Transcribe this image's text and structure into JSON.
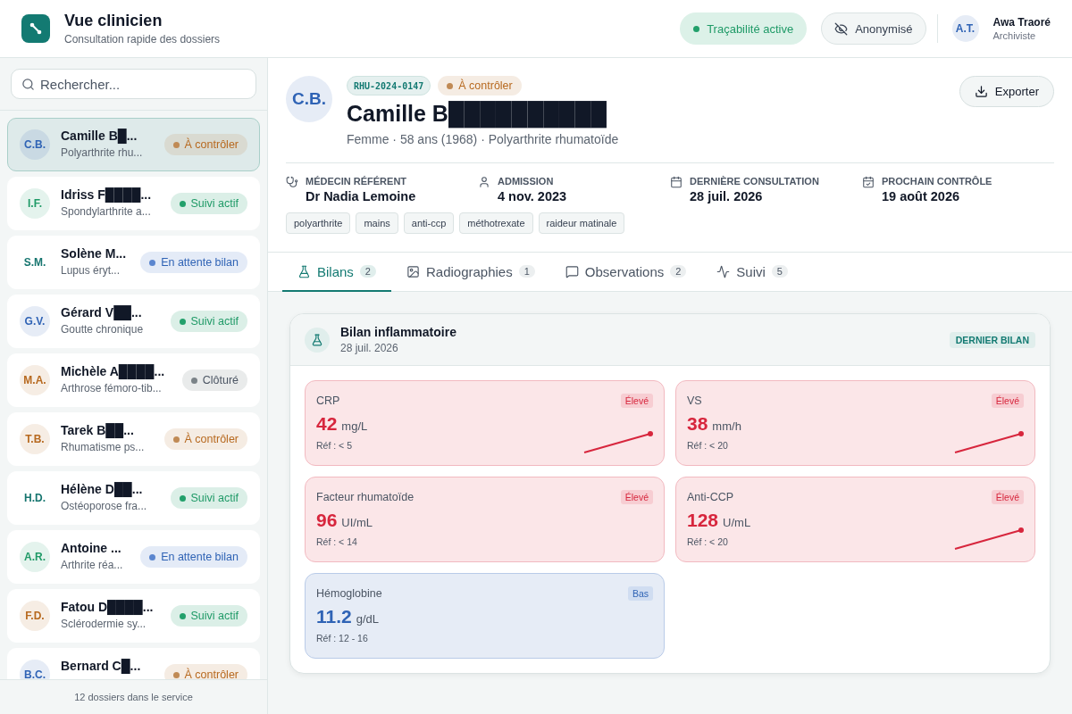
{
  "app": {
    "title": "Vue clinicien",
    "subtitle": "Consultation rapide des dossiers"
  },
  "header_actions": [
    {
      "kind": "status",
      "label": "Traçabilité active",
      "on": true
    },
    {
      "kind": "toggle",
      "label": "Anonymisé",
      "on": false
    }
  ],
  "user": {
    "initials": "A.T.",
    "name": "Awa Traoré",
    "role": "Archiviste"
  },
  "search": {
    "placeholder": "Rechercher..."
  },
  "patients": [
    {
      "avatar": {
        "initials": "C.B.",
        "color": "#2f63b5"
      },
      "name": "Camille B█...",
      "condition": "Polyarthrite rhu...",
      "status": {
        "label": "À contrôler",
        "color": "#c08a55"
      },
      "selected": true
    },
    {
      "avatar": {
        "initials": "I.F.",
        "color": "#1f9a67"
      },
      "name": "Idriss F████...",
      "condition": "Spondylarthrite a...",
      "status": {
        "label": "Suivi actif",
        "color": "#22a06b"
      },
      "selected": false
    },
    {
      "avatar": {
        "initials": "S.M.",
        "color": "#16756f"
      },
      "name": "Solène M...",
      "condition": "Lupus éryt...",
      "status": {
        "label": "En attente bilan",
        "color": "#5b86cf"
      },
      "selected": false
    },
    {
      "avatar": {
        "initials": "G.V.",
        "color": "#2f63b5"
      },
      "name": "Gérard V██...",
      "condition": "Goutte chronique",
      "status": {
        "label": "Suivi actif",
        "color": "#22a06b"
      },
      "selected": false
    },
    {
      "avatar": {
        "initials": "M.A.",
        "color": "#b7691f"
      },
      "name": "Michèle A████...",
      "condition": "Arthrose fémoro-tib...",
      "status": {
        "label": "Clôturé",
        "color": "#7b8388"
      },
      "selected": false
    },
    {
      "avatar": {
        "initials": "T.B.",
        "color": "#b7691f"
      },
      "name": "Tarek B██...",
      "condition": "Rhumatisme ps...",
      "status": {
        "label": "À contrôler",
        "color": "#c08a55"
      },
      "selected": false
    },
    {
      "avatar": {
        "initials": "H.D.",
        "color": "#16756f"
      },
      "name": "Hélène D██...",
      "condition": "Ostéoporose fra...",
      "status": {
        "label": "Suivi actif",
        "color": "#22a06b"
      },
      "selected": false
    },
    {
      "avatar": {
        "initials": "A.R.",
        "color": "#1f9a67"
      },
      "name": "Antoine ...",
      "condition": "Arthrite réa...",
      "status": {
        "label": "En attente bilan",
        "color": "#5b86cf"
      },
      "selected": false
    },
    {
      "avatar": {
        "initials": "F.D.",
        "color": "#b7691f"
      },
      "name": "Fatou D████...",
      "condition": "Sclérodermie sy...",
      "status": {
        "label": "Suivi actif",
        "color": "#22a06b"
      },
      "selected": false
    },
    {
      "avatar": {
        "initials": "B.C.",
        "color": "#2f63b5"
      },
      "name": "Bernard C█...",
      "status": {
        "label": "À contrôler",
        "color": "#c08a55"
      },
      "selected": false
    }
  ],
  "list_footer": "12 dossiers dans le service",
  "patient": {
    "avatar": {
      "initials": "C.B.",
      "color": "#2f63b5"
    },
    "record_id": "RHU-2024-0147",
    "status": {
      "label": "À contrôler",
      "color": "#c08a55"
    },
    "name": "Camille B██████████",
    "summary": "Femme · 58 ans (1968) · Polyarthrite rhumatoïde",
    "export": "Exporter",
    "facts": [
      {
        "label": "MÉDECIN RÉFÉRENT",
        "value": "Dr Nadia Lemoine"
      },
      {
        "label": "ADMISSION",
        "value": "4 nov. 2023"
      },
      {
        "label": "DERNIÈRE CONSULTATION",
        "value": "28 juil. 2026"
      },
      {
        "label": "PROCHAIN CONTRÔLE",
        "value": "19 août 2026"
      }
    ],
    "tags": [
      "polyarthrite",
      "mains",
      "anti-ccp",
      "méthotrexate",
      "raideur matinale"
    ]
  },
  "tabs": [
    {
      "label": "Bilans",
      "count": "2",
      "selected": true
    },
    {
      "label": "Radiographies",
      "count": "1",
      "selected": false
    },
    {
      "label": "Observations",
      "count": "2",
      "selected": false
    },
    {
      "label": "Suivi",
      "count": "5",
      "selected": false
    }
  ],
  "panels": [
    {
      "title": "Bilan inflammatoire",
      "date": "28 juil. 2026",
      "badge": "DERNIER BILAN",
      "results": [
        {
          "name": "CRP",
          "value": "42",
          "unit": "mg/L",
          "ref": "Réf : < 5",
          "flag": "Élevé",
          "kind": "high",
          "trend": true
        },
        {
          "name": "VS",
          "value": "38",
          "unit": "mm/h",
          "ref": "Réf : < 20",
          "flag": "Élevé",
          "kind": "high",
          "trend": true
        },
        {
          "name": "Facteur rhumatoïde",
          "value": "96",
          "unit": "UI/mL",
          "ref": "Réf : < 14",
          "flag": "Élevé",
          "kind": "high",
          "trend": false
        },
        {
          "name": "Anti-CCP",
          "value": "128",
          "unit": "U/mL",
          "ref": "Réf : < 20",
          "flag": "Élevé",
          "kind": "high",
          "trend": true
        },
        {
          "name": "Hémoglobine",
          "value": "11.2",
          "unit": "g/dL",
          "ref": "Réf : 12 - 16",
          "flag": "Bas",
          "kind": "low",
          "trend": false
        }
      ]
    }
  ]
}
